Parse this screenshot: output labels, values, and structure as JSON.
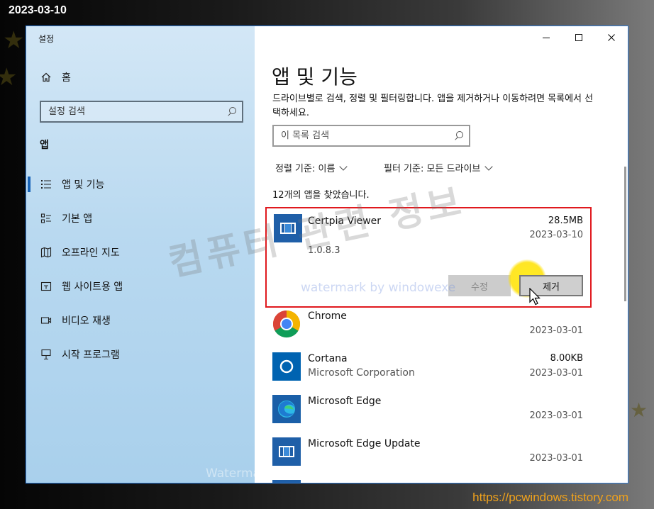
{
  "overlay": {
    "date_stamp": "2023-03-10",
    "site_url": "https://pcwindows.tistory.com",
    "watermark_large": "컴퓨터 관련 정보",
    "watermark_small": "watermark by windowexe",
    "watermark_bottom": "Watermarked by WindowexeWatermark"
  },
  "window": {
    "title": "설정",
    "controls": {
      "minimize": "—",
      "maximize": "☐",
      "close": "✕"
    }
  },
  "sidebar": {
    "home_label": "홈",
    "search_placeholder": "설정 검색",
    "section_title": "앱",
    "items": [
      {
        "label": "앱 및 기능",
        "icon": "apps-features-icon",
        "active": true
      },
      {
        "label": "기본 앱",
        "icon": "default-apps-icon",
        "active": false
      },
      {
        "label": "오프라인 지도",
        "icon": "offline-maps-icon",
        "active": false
      },
      {
        "label": "웹 사이트용 앱",
        "icon": "apps-for-websites-icon",
        "active": false
      },
      {
        "label": "비디오 재생",
        "icon": "video-playback-icon",
        "active": false
      },
      {
        "label": "시작 프로그램",
        "icon": "startup-icon",
        "active": false
      }
    ]
  },
  "main": {
    "title": "앱 및 기능",
    "description": "드라이브별로 검색, 정렬 및 필터링합니다. 앱을 제거하거나 이동하려면 목록에서 선택하세요.",
    "search_placeholder": "이 목록 검색",
    "sort_label": "정렬 기준: 이름",
    "filter_label": "필터 기준: 모든 드라이브",
    "found_count": "12개의 앱을 찾았습니다.",
    "selected_app": {
      "name": "Certpia Viewer",
      "size": "28.5MB",
      "date": "2023-03-10",
      "version": "1.0.8.3",
      "modify_label": "수정",
      "uninstall_label": "제거"
    },
    "apps": [
      {
        "name": "Chrome",
        "publisher": "",
        "size": "",
        "date": "2023-03-01"
      },
      {
        "name": "Cortana",
        "publisher": "Microsoft Corporation",
        "size": "8.00KB",
        "date": "2023-03-01"
      },
      {
        "name": "Microsoft Edge",
        "publisher": "",
        "size": "",
        "date": "2023-03-01"
      },
      {
        "name": "Microsoft Edge Update",
        "publisher": "",
        "size": "",
        "date": "2023-03-01"
      }
    ]
  },
  "colors": {
    "accent": "#1663b8",
    "selection_border": "#e0191e",
    "cursor_highlight": "#ffe100",
    "url_text": "#f0a21c"
  }
}
